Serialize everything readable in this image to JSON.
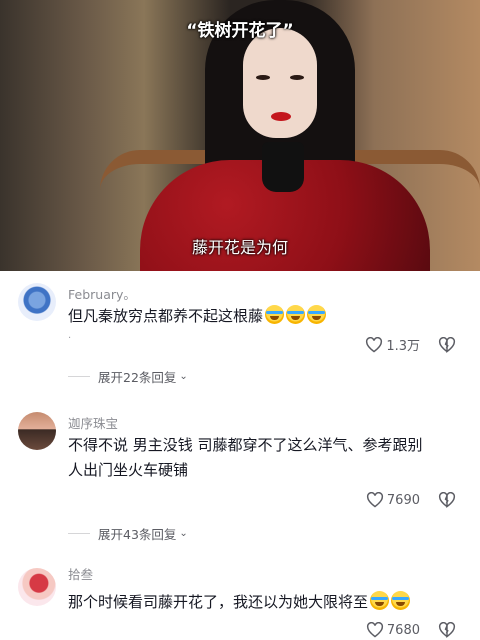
{
  "video": {
    "caption_top": "“铁树开花了”",
    "caption_bottom": "藤开花是为何"
  },
  "comments": [
    {
      "username": "February。",
      "text": "但凡秦放穷点都养不起这根藤",
      "emoji_icon": "crying-laughing-emoji",
      "emoji_count": 3,
      "extra_mark": "·",
      "likes": "1.3万",
      "replies": "展开22条回复"
    },
    {
      "username": "迦序珠宝",
      "text_line1": "不得不说 男主没钱 司藤都穿不了这么洋气、参考跟别",
      "text_line2": "人出门坐火车硬铺",
      "likes": "7690",
      "replies": "展开43条回复"
    },
    {
      "username": "拾叁",
      "text": "那个时候看司藤开花了，我还以为她大限将至",
      "emoji_icon": "crying-laughing-emoji",
      "emoji_count": 2,
      "likes": "7680"
    }
  ],
  "colors": {
    "text": "#161823",
    "muted": "#8a8b91",
    "caption": "#ffffff"
  }
}
